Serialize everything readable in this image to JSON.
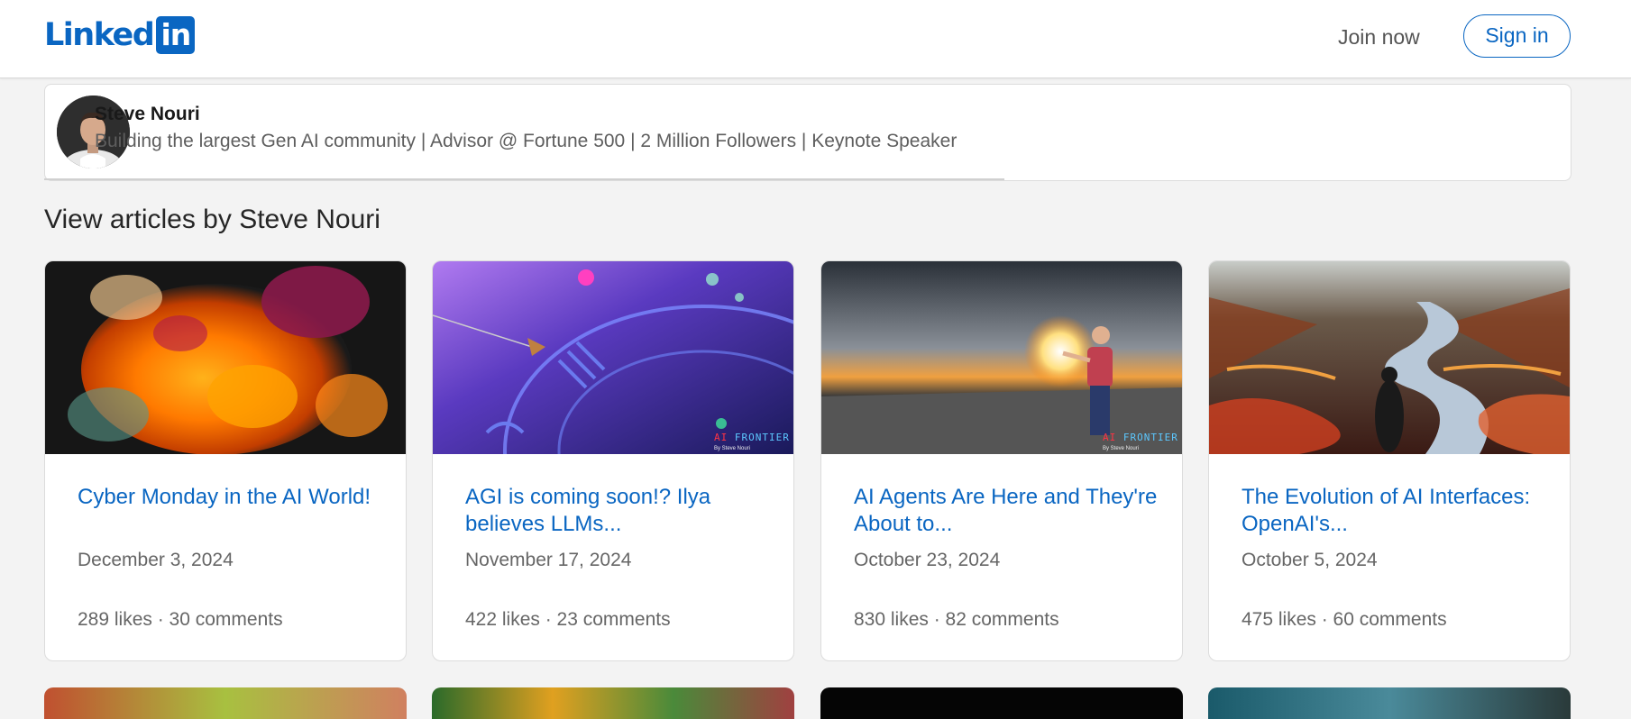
{
  "header": {
    "logo_text": "Linked",
    "logo_box": "in",
    "join_label": "Join now",
    "signin_label": "Sign in"
  },
  "profile": {
    "name": "Steve Nouri",
    "headline": "Building the largest Gen AI community | Advisor @ Fortune 500 | 2 Million Followers | Keynote Speaker"
  },
  "section": {
    "title": "View articles by Steve Nouri"
  },
  "articles": [
    {
      "title": "Cyber Monday in the AI World!",
      "date": "December 3, 2024",
      "stats": "289 likes · 30 comments"
    },
    {
      "title": "AGI is coming soon!? Ilya believes LLMs...",
      "date": "November 17, 2024",
      "stats": "422 likes · 23 comments",
      "badge_a": "AI",
      "badge_b": " FRONTIER",
      "badge_sub": "By Steve Nouri"
    },
    {
      "title": "AI Agents Are Here and They're About to...",
      "date": "October 23, 2024",
      "stats": "830 likes · 82 comments",
      "badge_a": "AI",
      "badge_b": " FRONTIER",
      "badge_sub": "By Steve Nouri"
    },
    {
      "title": "The Evolution of AI Interfaces: OpenAI's...",
      "date": "October 5, 2024",
      "stats": "475 likes · 60 comments"
    }
  ],
  "colors": {
    "brand": "#0a66c2",
    "background": "#f3f3f3"
  }
}
